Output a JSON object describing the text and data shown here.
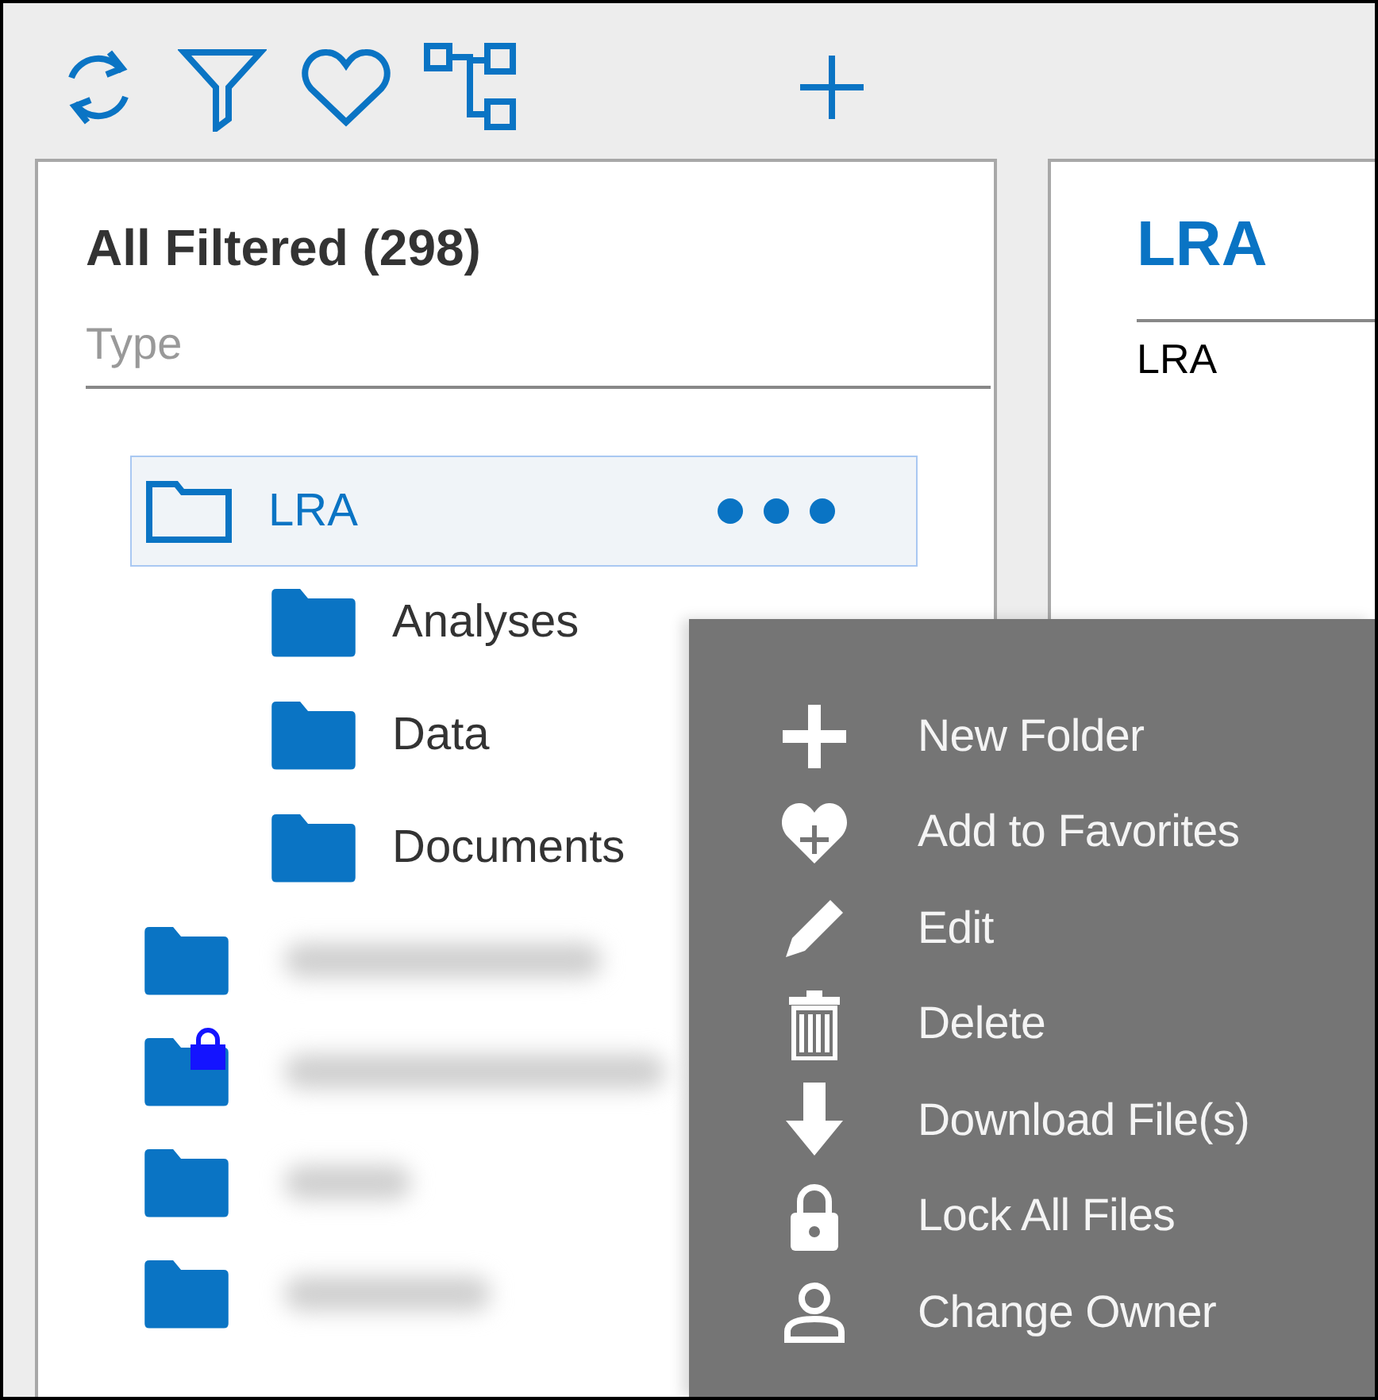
{
  "toolbar": {
    "buttons": [
      {
        "kind": "refresh"
      },
      {
        "kind": "filter"
      },
      {
        "kind": "favorite"
      },
      {
        "kind": "hierarchy"
      },
      {
        "kind": "add"
      }
    ]
  },
  "tree_panel": {
    "title": "All Filtered (298)",
    "search": {
      "placeholder": "Type"
    },
    "items": [
      {
        "label": "LRA",
        "kind": "folder",
        "selected": true,
        "expanded": true,
        "children": [
          {
            "label": "Analyses"
          },
          {
            "label": "Data"
          },
          {
            "label": "Documents"
          }
        ]
      },
      {
        "kind": "redacted",
        "locked": false
      },
      {
        "kind": "redacted",
        "locked": true
      },
      {
        "kind": "redacted",
        "locked": false
      },
      {
        "kind": "redacted",
        "locked": false
      }
    ]
  },
  "detail_panel": {
    "title": "LRA",
    "field_value": "LRA"
  },
  "context_menu": {
    "items": [
      {
        "label": "New Folder",
        "kind": "plus"
      },
      {
        "label": "Add to Favorites",
        "kind": "heart"
      },
      {
        "label": "Edit",
        "kind": "pencil"
      },
      {
        "label": "Delete",
        "kind": "trash"
      },
      {
        "label": "Download File(s)",
        "kind": "download"
      },
      {
        "label": "Lock All Files",
        "kind": "lock"
      },
      {
        "label": "Change Owner",
        "kind": "person"
      }
    ]
  }
}
